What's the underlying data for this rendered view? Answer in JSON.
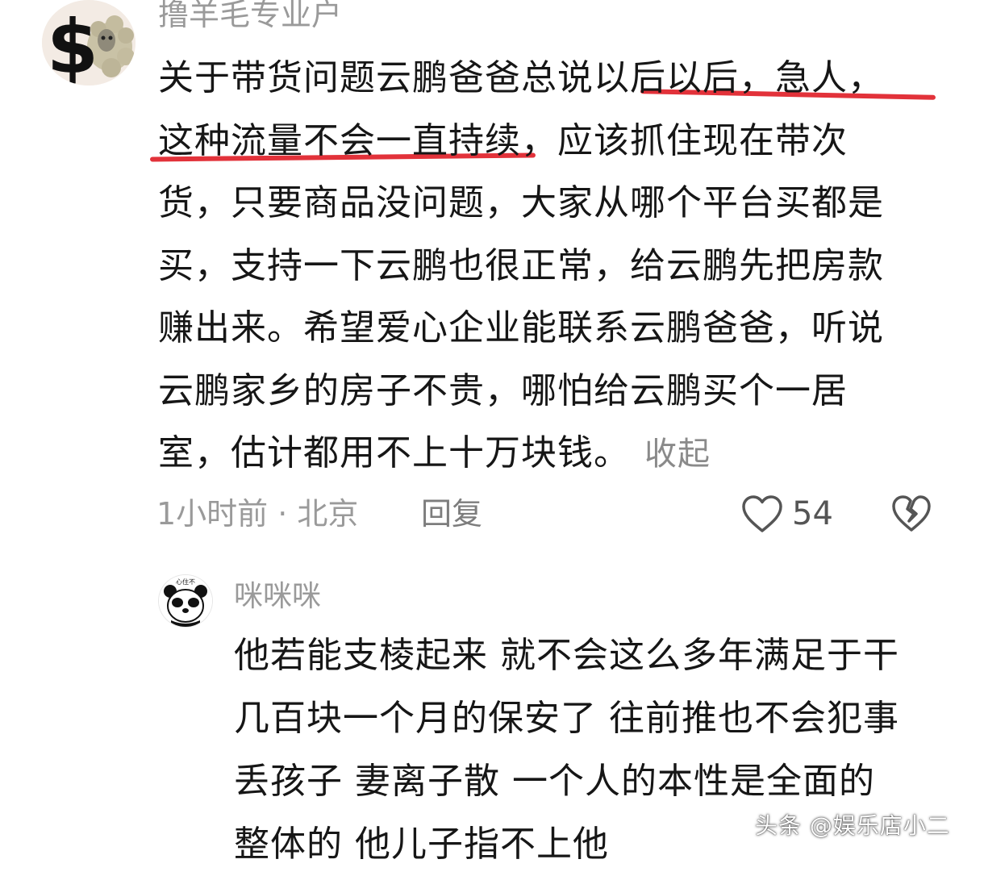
{
  "comment": {
    "username": "撸羊毛专业户",
    "avatar_icon": "dollar-sheep-avatar-icon",
    "text_lines": [
      "关于带货问题云鹏爸爸总说以后以后，急人，",
      "这种流量不会一直持续，应该抓住现在带次",
      "货，只要商品没问题，大家从哪个平台买都是",
      "买，支持一下云鹏也很正常，给云鹏先把房款",
      "赚出来。希望爱心企业能联系云鹏爸爸，听说",
      "云鹏家乡的房子不贵，哪怕给云鹏买个一居",
      "室，估计都用不上十万块钱。"
    ],
    "collapse_label": "收起",
    "meta_time_location": "1小时前 · 北京",
    "reply_label": "回复",
    "like_icon": "heart-outline-icon",
    "like_count": "54",
    "dislike_icon": "broken-heart-icon",
    "highlight_color": "#e2323a"
  },
  "reply": {
    "username": "咪咪咪",
    "avatar_icon": "panda-face-avatar-icon",
    "avatar_caption": "心住不",
    "text_lines": [
      "他若能支棱起来 就不会这么多年满足于干",
      "几百块一个月的保安了 往前推也不会犯事",
      "丢孩子 妻离子散 一个人的本性是全面的",
      "整体的 他儿子指不上他"
    ]
  },
  "watermark": "头条 @娱乐店小二"
}
